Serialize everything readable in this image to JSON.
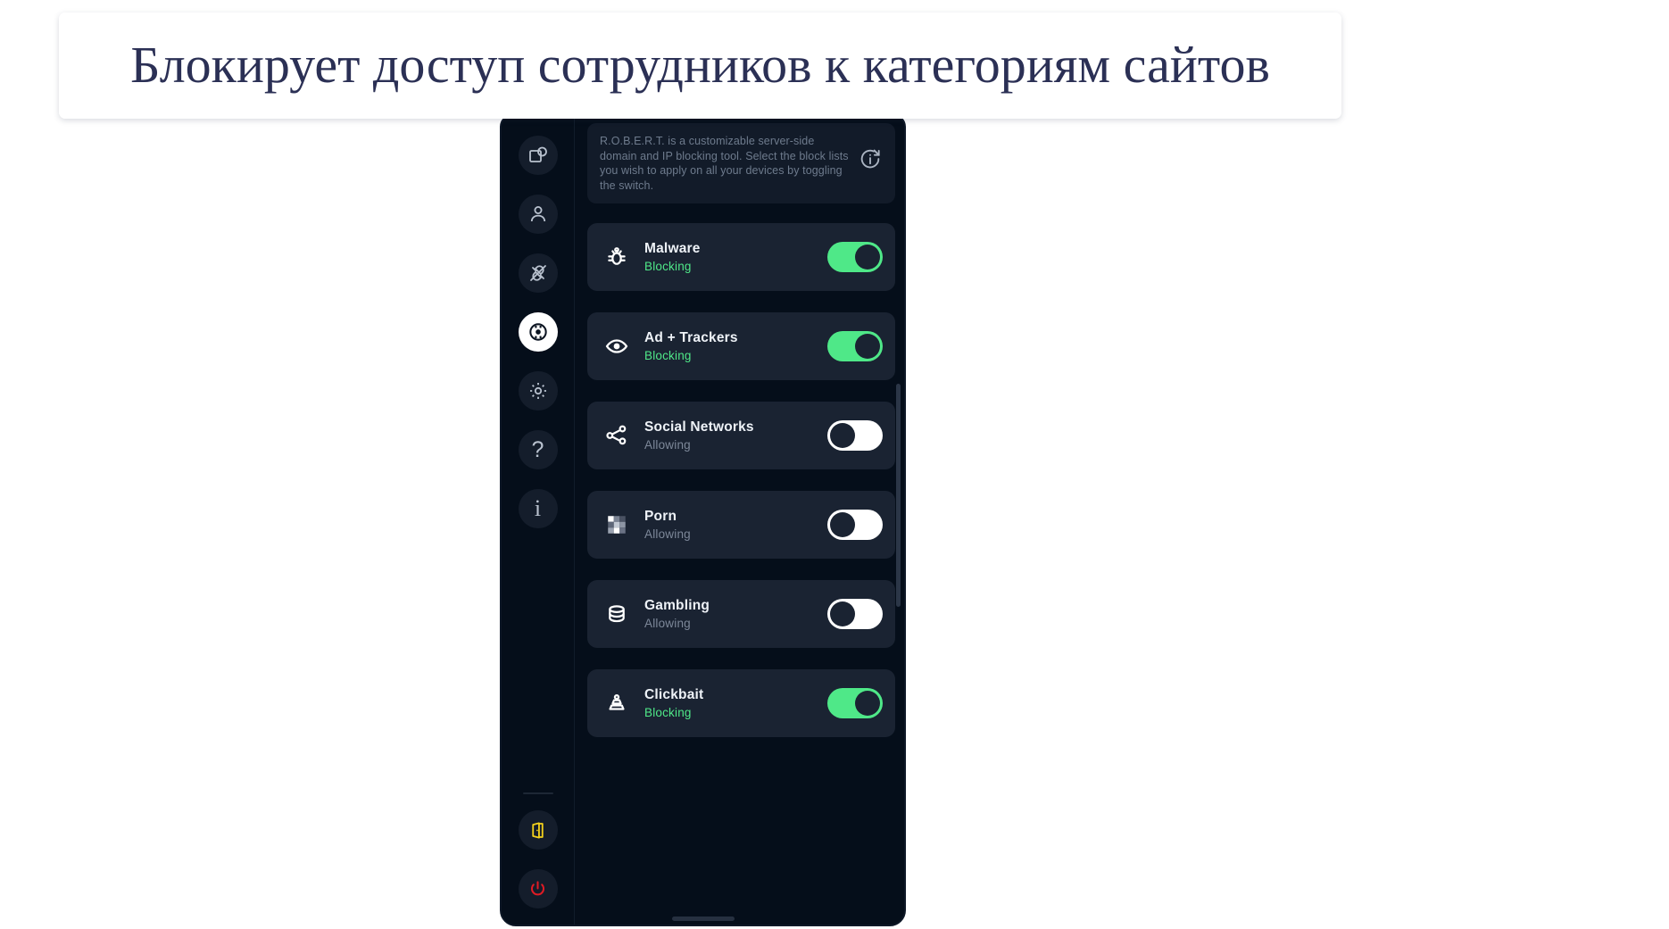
{
  "banner": {
    "text": "Блокирует доступ сотрудников к категориям сайтов",
    "text_color": "#2b3055",
    "background": "#ffffff"
  },
  "app": {
    "background": "#050e1a",
    "info_card": {
      "text": "R.O.B.E.R.T. is a customizable server-side domain and IP blocking tool. Select the block lists you wish to apply on all your devices by toggling the switch.",
      "badge_icon": "info-external-link-icon"
    },
    "sidebar": {
      "items": [
        {
          "name": "devices",
          "icon": "devices-icon",
          "active": false
        },
        {
          "name": "account",
          "icon": "person-icon",
          "active": false
        },
        {
          "name": "connection",
          "icon": "plug-disconnected-icon",
          "active": false
        },
        {
          "name": "robert",
          "icon": "robert-target-icon",
          "active": true
        },
        {
          "name": "settings",
          "icon": "gear-icon",
          "active": false
        },
        {
          "name": "help",
          "icon": "question-mark-icon",
          "active": false
        },
        {
          "name": "about",
          "icon": "info-icon",
          "active": false
        }
      ],
      "bottom_items": [
        {
          "name": "exit",
          "icon": "exit-door-icon",
          "color": "#f3d11c"
        },
        {
          "name": "power",
          "icon": "power-icon",
          "color": "#e01b24"
        }
      ]
    },
    "colors": {
      "toggle_on": "#4fe888",
      "toggle_off": "#ffffff",
      "status_blocking": "#4fe888",
      "status_allowing": "#7d8899",
      "row_background": "#1a2332"
    },
    "status_labels": {
      "blocking": "Blocking",
      "allowing": "Allowing"
    },
    "blocklists": [
      {
        "title": "Malware",
        "status": "Blocking",
        "enabled": true,
        "icon": "bug-icon"
      },
      {
        "title": "Ad + Trackers",
        "status": "Blocking",
        "enabled": true,
        "icon": "eye-icon"
      },
      {
        "title": "Social Networks",
        "status": "Allowing",
        "enabled": false,
        "icon": "share-nodes-icon"
      },
      {
        "title": "Porn",
        "status": "Allowing",
        "enabled": false,
        "icon": "pixelated-censor-icon"
      },
      {
        "title": "Gambling",
        "status": "Allowing",
        "enabled": false,
        "icon": "poker-chips-icon"
      },
      {
        "title": "Clickbait",
        "status": "Blocking",
        "enabled": true,
        "icon": "fishing-lure-icon"
      }
    ]
  }
}
